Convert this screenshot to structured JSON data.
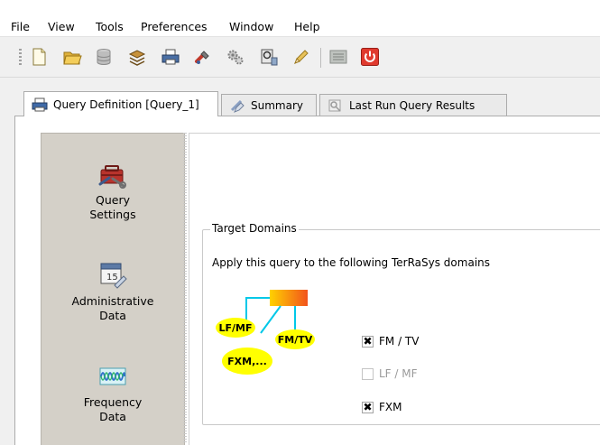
{
  "menu": [
    "File",
    "View",
    "Tools",
    "Preferences",
    "Window",
    "Help"
  ],
  "toolbar": {
    "buttons": [
      "new-document-icon",
      "open-folder-icon",
      "database-icon",
      "stack-icon",
      "printer-icon",
      "tools-icon",
      "settings-gears-icon",
      "query-icon",
      "edit-icon",
      "grid-icon",
      "power-icon"
    ],
    "accent_power": "#e03a2f"
  },
  "tabs": [
    {
      "label": "Query Definition [Query_1]",
      "icon": "printer-icon",
      "active": true
    },
    {
      "label": "Summary",
      "icon": "summary-icon",
      "active": false
    },
    {
      "label": "Last Run Query Results",
      "icon": "results-icon",
      "active": false
    }
  ],
  "sidebar": {
    "items": [
      {
        "label_1": "Query",
        "label_2": "Settings",
        "icon": "toolbox-icon",
        "selected": true
      },
      {
        "label_1": "Administrative",
        "label_2": "Data",
        "icon": "calendar-icon",
        "selected": false
      },
      {
        "label_1": "Frequency",
        "label_2": "Data",
        "icon": "frequency-wave-icon",
        "selected": false
      }
    ]
  },
  "target_domains": {
    "title": "Target Domains",
    "description": "Apply this query to the following TerRaSys domains",
    "diagram_labels": {
      "lfmf": "LF/MF",
      "fmtv": "FM/TV",
      "fxm": "FXM,..."
    },
    "checkboxes": [
      {
        "label": "FM / TV",
        "checked": true,
        "enabled": true
      },
      {
        "label": "LF / MF",
        "checked": false,
        "enabled": false
      },
      {
        "label": "FXM",
        "checked": true,
        "enabled": true
      }
    ],
    "check_mark": "✖"
  }
}
